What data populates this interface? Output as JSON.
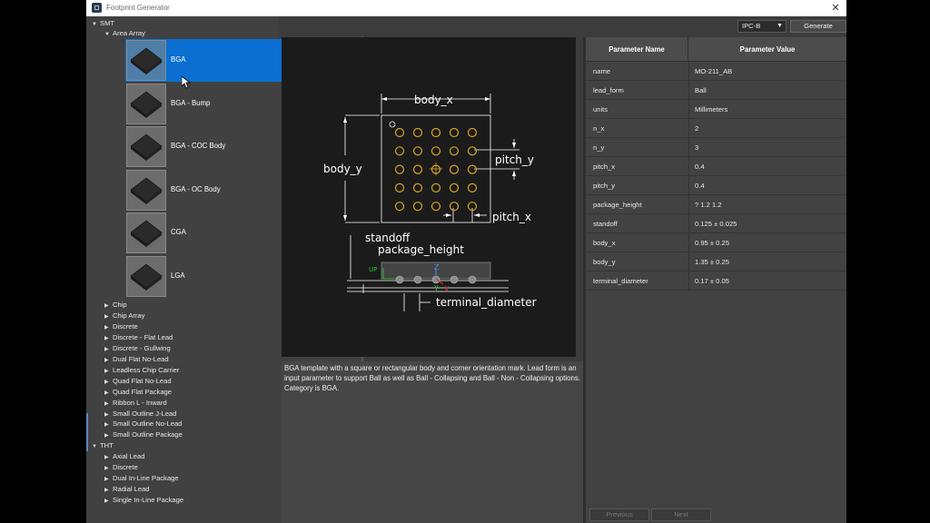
{
  "window": {
    "title": "Footprint Generator"
  },
  "tree": {
    "root_smt": "SMT",
    "group_area_array": "Area Array",
    "tiles": [
      {
        "label": "BGA"
      },
      {
        "label": "BGA - Bump"
      },
      {
        "label": "BGA - COC Body"
      },
      {
        "label": "BGA - OC Body"
      },
      {
        "label": "CGA"
      },
      {
        "label": "LGA"
      }
    ],
    "smt_items": [
      "Chip",
      "Chip Array",
      "Discrete",
      "Discrete - Flat Lead",
      "Discrete - Gullwing",
      "Dual Flat No-Lead",
      "Leadless Chip Carrier",
      "Quad Flat No-Lead",
      "Quad Flat Package",
      "Ribbon L - Inward",
      "Small Outline J-Lead",
      "Small Outline No-Lead",
      "Small Outline Package"
    ],
    "root_tht": "THT",
    "tht_items": [
      "Axial Lead",
      "Discrete",
      "Dual In-Line Package",
      "Radial Lead",
      "Single In-Line Package"
    ]
  },
  "toolbar": {
    "standard": "IPC-B",
    "generate_label": "Generate"
  },
  "diagram": {
    "body_x": "body_x",
    "body_y": "body_y",
    "pitch_y": "pitch_y",
    "pitch_x": "pitch_x",
    "standoff": "standoff",
    "package_height": "package_height",
    "terminal_diameter": "terminal_diameter",
    "axis_up": "UP",
    "axis_z": "Z",
    "axis_y": "Y",
    "axis_x": "X"
  },
  "description": "BGA template with a square or rectangular body and corner orientation mark. Lead form is an input parameter to support Ball as well as Ball - Collapsing and Ball - Non - Collapsing options. Category is BGA.",
  "params": {
    "col_name": "Parameter Name",
    "col_value": "Parameter Value",
    "rows": [
      {
        "name": "name",
        "value": "MO-211_AB"
      },
      {
        "name": "lead_form",
        "value": "Ball"
      },
      {
        "name": "units",
        "value": "Millimeters"
      },
      {
        "name": "n_x",
        "value": "2"
      },
      {
        "name": "n_y",
        "value": "3"
      },
      {
        "name": "pitch_x",
        "value": "0.4"
      },
      {
        "name": "pitch_y",
        "value": "0.4"
      },
      {
        "name": "package_height",
        "value": "? 1.2 1.2"
      },
      {
        "name": "standoff",
        "value": "0.125 ± 0.025"
      },
      {
        "name": "body_x",
        "value": "0.95 ± 0.25"
      },
      {
        "name": "body_y",
        "value": "1.35 ± 0.25"
      },
      {
        "name": "terminal_diameter",
        "value": "0.17 ± 0.05"
      }
    ],
    "previous_label": "Previous",
    "next_label": "Next"
  },
  "colors": {
    "selection": "#0a6fd0",
    "pad": "#d9a520",
    "axis_green": "#2fc02f",
    "axis_blue": "#4a8cf0",
    "axis_red": "#e03030"
  }
}
